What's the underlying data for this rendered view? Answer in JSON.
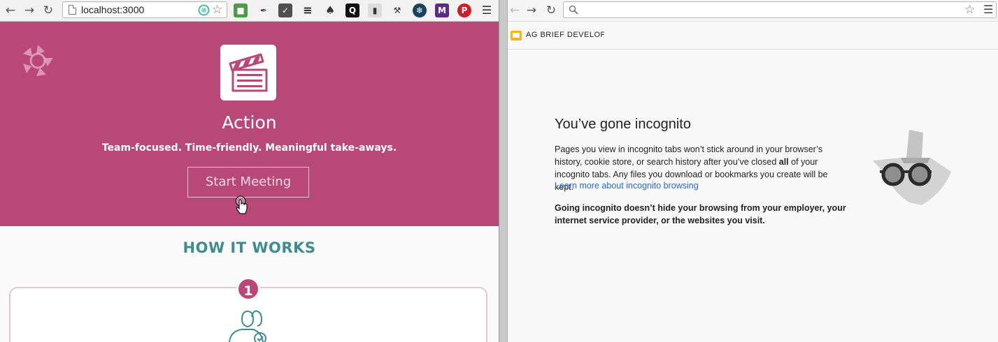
{
  "left_browser": {
    "url": "localhost:3000",
    "extensions": [
      "evernote-web-clipper",
      "eyedropper",
      "pocket",
      "buffer",
      "quip",
      "clipboard",
      "tool",
      "star",
      "moonlight",
      "pinterest"
    ],
    "hero": {
      "title": "Action",
      "tagline": "Team-focused. Time-friendly. Meaningful take-aways.",
      "start_button": "Start Meeting"
    },
    "how_it_works": {
      "title": "HOW IT WORKS",
      "step_number": "1"
    }
  },
  "right_browser": {
    "bookmark_label": "AG BRIEF DEVELOPM",
    "incognito": {
      "title": "You’ve gone incognito",
      "body_before_bold": "Pages you view in incognito tabs won’t stick around in your browser’s history, cookie store, or search history after you’ve closed ",
      "body_bold": "all",
      "body_after_bold": " of your incognito tabs. Any files you download or bookmarks you create will be kept.",
      "link": "Learn more about incognito browsing",
      "warning": "Going incognito doesn’t hide your browsing from your employer, your internet service provider, or the websites you visit."
    }
  },
  "colors": {
    "hero_bg": "#b74878",
    "teal": "#3f8b90",
    "link": "#2a67d2"
  }
}
